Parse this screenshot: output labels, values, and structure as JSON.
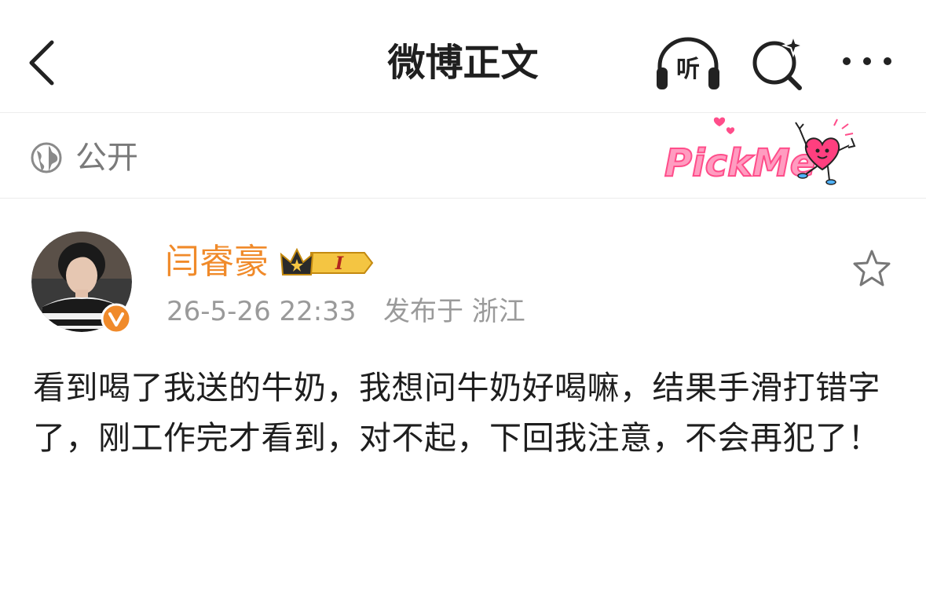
{
  "header": {
    "title": "微博正文",
    "back_icon": "chevron-left-icon",
    "listen_label": "听",
    "listen_icon": "headphones-icon",
    "search_icon": "sparkle-search-icon",
    "more_icon": "more-dots-icon"
  },
  "visibility": {
    "icon": "globe-icon",
    "label": "公开",
    "sticker_text": "PickMe"
  },
  "post": {
    "author": {
      "name": "闫睿豪",
      "verified": true,
      "vip_level": "I",
      "verified_color": "#f08a2a"
    },
    "time": "26-5-26 22:33",
    "location": "发布于 浙江",
    "favorite_icon": "star-outline-icon",
    "text": "看到喝了我送的牛奶，我想问牛奶好喝嘛，结果手滑打错字了，刚工作完才看到，对不起，下回我注意，不会再犯了！"
  },
  "colors": {
    "accent": "#f08a2a",
    "muted": "#9a9a9a",
    "title": "#1f1f1f",
    "sticker_pink": "#ff5a8a"
  }
}
